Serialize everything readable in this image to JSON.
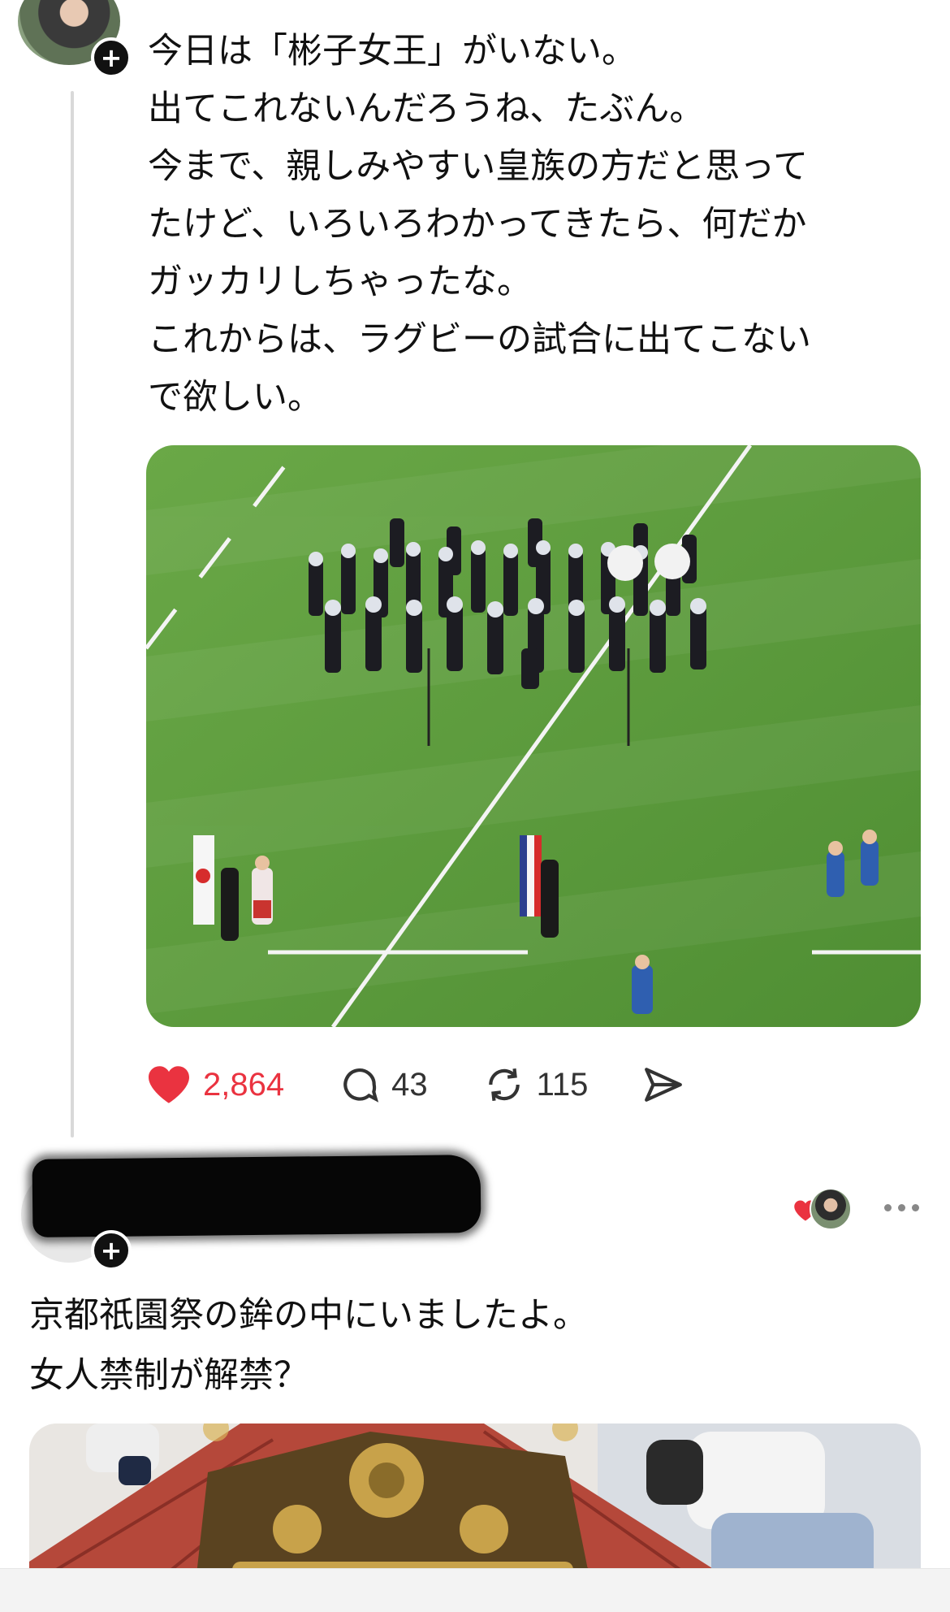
{
  "post1": {
    "lines": [
      "今日は「彬子女王」がいない。",
      "出てこれないんだろうね、たぶん。",
      "今まで、親しみやすい皇族の方だと思って",
      "たけど、いろいろわかってきたら、何だか",
      "ガッカリしちゃったな。",
      "これからは、ラグビーの試合に出てこない",
      "で欲しい。"
    ],
    "follow_glyph": "+",
    "likes": "2,864",
    "replies": "43",
    "reposts": "115",
    "colors": {
      "like": "#ea3340",
      "field": "#5f9e3c"
    }
  },
  "post2": {
    "follow_glyph": "+",
    "lines": [
      "京都祇園祭の鉾の中にいましたよ。",
      "女人禁制が解禁？"
    ]
  }
}
